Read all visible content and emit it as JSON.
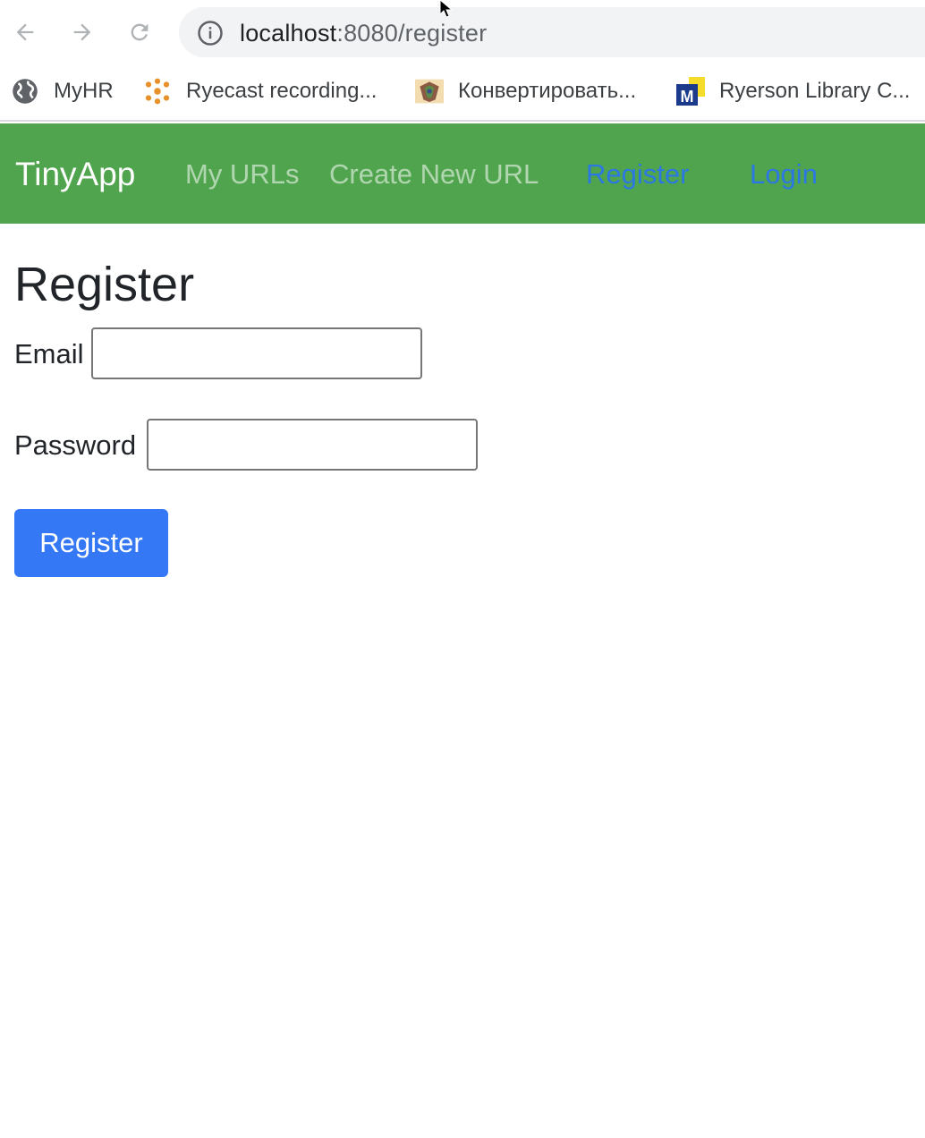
{
  "browser": {
    "url_host": "localhost",
    "url_rest": ":8080/register",
    "bookmarks": [
      {
        "label": "MyHR",
        "icon": "globe-icon"
      },
      {
        "label": "Ryecast recording...",
        "icon": "ryecast-icon"
      },
      {
        "label": "Конвертировать...",
        "icon": "converter-icon"
      },
      {
        "label": "Ryerson Library C...",
        "icon": "library-icon"
      }
    ]
  },
  "navbar": {
    "brand": "TinyApp",
    "links": {
      "my_urls": "My URLs",
      "create_new_url": "Create New URL",
      "register": "Register",
      "login": "Login"
    },
    "background_color": "#51a44e"
  },
  "form": {
    "title": "Register",
    "email_label": "Email",
    "email_value": "",
    "password_label": "Password",
    "password_value": "",
    "submit_label": "Register",
    "submit_color": "#3478f6"
  }
}
